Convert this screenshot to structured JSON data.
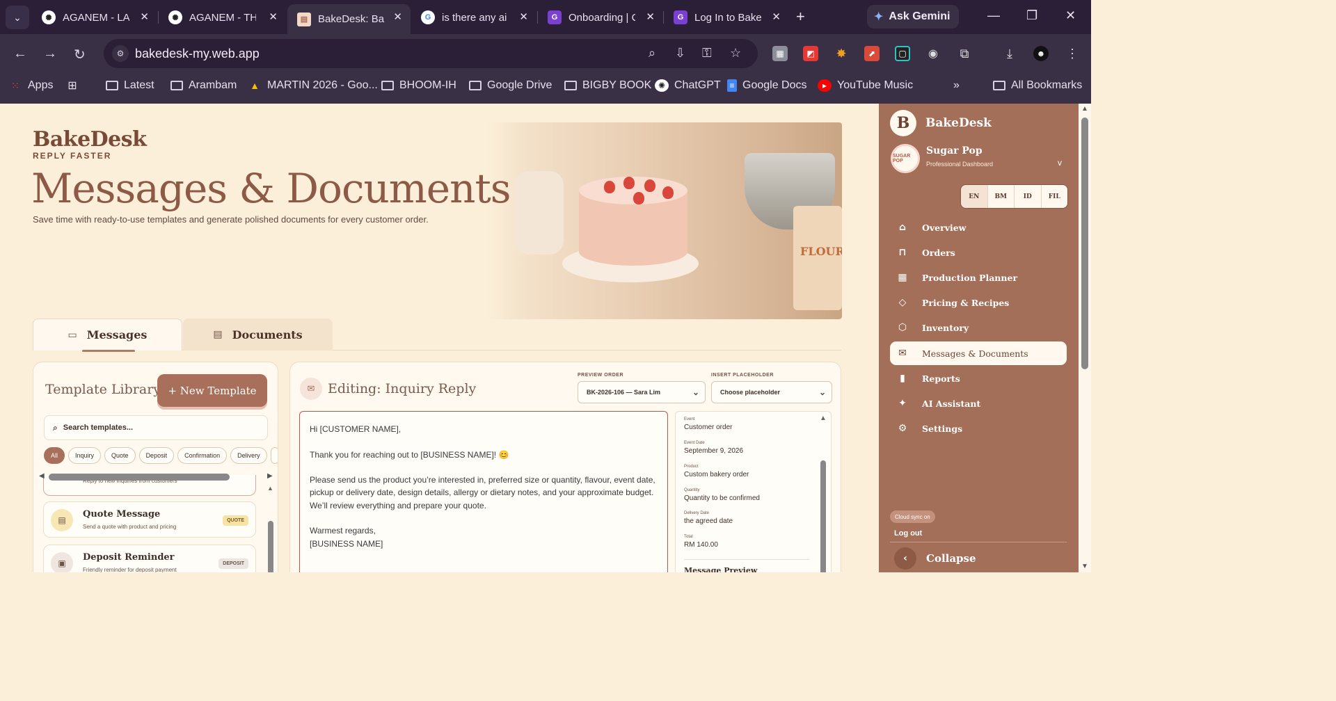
{
  "browser": {
    "tabs": [
      {
        "title": "AGANEM - LA",
        "favicon": "openai-icon"
      },
      {
        "title": "AGANEM - TH",
        "favicon": "openai-icon"
      },
      {
        "title": "BakeDesk: Bak",
        "favicon": "bakedesk-icon"
      },
      {
        "title": "is there any ai",
        "favicon": "google-icon"
      },
      {
        "title": "Onboarding | C",
        "favicon": "g-icon"
      },
      {
        "title": "Log In to Bake",
        "favicon": "g-icon"
      }
    ],
    "active_tab": 2,
    "gemini_label": "Ask Gemini",
    "url": "bakedesk-my.web.app",
    "bookmarks": [
      {
        "label": "Apps",
        "icon": "apps-grid-icon"
      },
      {
        "label": "",
        "icon": "grid-icon"
      },
      {
        "label": "Latest",
        "icon": "folder-icon"
      },
      {
        "label": "Arambam",
        "icon": "folder-icon"
      },
      {
        "label": "MARTIN 2026 - Goo...",
        "icon": "drive-icon"
      },
      {
        "label": "BHOOM-IH",
        "icon": "folder-icon"
      },
      {
        "label": "Google Drive",
        "icon": "folder-icon"
      },
      {
        "label": "BIGBY BOOK",
        "icon": "folder-icon"
      },
      {
        "label": "ChatGPT",
        "icon": "openai-icon"
      },
      {
        "label": "Google Docs",
        "icon": "docs-icon"
      },
      {
        "label": "YouTube Music",
        "icon": "youtube-music-icon"
      }
    ],
    "all_bookmarks": "All Bookmarks"
  },
  "hero": {
    "brand": "BakeDesk",
    "brand_tagline": "REPLY FASTER",
    "title": "Messages & Documents",
    "subtitle": "Save time with ready-to-use templates and generate polished documents for every customer order."
  },
  "page_tabs": {
    "messages": "Messages",
    "documents": "Documents"
  },
  "library": {
    "title": "Template Library",
    "new_button": "+ New Template",
    "search_placeholder": "Search templates...",
    "chips": [
      "All",
      "Inquiry",
      "Quote",
      "Deposit",
      "Confirmation",
      "Delivery"
    ],
    "active_chip": "All",
    "first_desc": "Reply to new inquiries from customers",
    "templates": [
      {
        "name": "Quote Message",
        "desc": "Send a quote with product and pricing",
        "tag": "QUOTE",
        "tag_color": "#f7e3a4"
      },
      {
        "name": "Deposit Reminder",
        "desc": "Friendly reminder for deposit payment",
        "tag": "DEPOSIT",
        "tag_color": "#ece6e3"
      }
    ]
  },
  "editor": {
    "title": "Editing: Inquiry Reply",
    "preview_order_label": "PREVIEW ORDER",
    "preview_order_value": "BK-2026-106 — Sara Lim",
    "placeholder_label": "INSERT PLACEHOLDER",
    "placeholder_value": "Choose placeholder",
    "message_lines": {
      "greeting": "Hi [CUSTOMER NAME],",
      "thanks": "Thank you for reaching out to [BUSINESS NAME]! 😊",
      "body": "Please send us the product you’re interested in, preferred size or quantity, flavour, event date, pickup or delivery date, design details, allergy or dietary notes, and your approximate budget. We’ll review everything and prepare your quote.",
      "closing": "Warmest regards,",
      "signature": "[BUSINESS NAME]"
    },
    "preview": [
      {
        "key": "Event",
        "value": "Customer order"
      },
      {
        "key": "Event Date",
        "value": "September 9, 2026"
      },
      {
        "key": "Product",
        "value": "Custom bakery order"
      },
      {
        "key": "Quantity",
        "value": "Quantity to be confirmed"
      },
      {
        "key": "Delivery Date",
        "value": "the agreed date"
      },
      {
        "key": "Total",
        "value": "RM 140.00"
      }
    ],
    "preview_more": "Message Preview"
  },
  "sidebar": {
    "logo_letter": "B",
    "app_name": "BakeDesk",
    "org_name": "Sugar Pop",
    "org_sub": "Professional Dashboard",
    "org_avatar_text": "SUGAR POP",
    "languages": [
      "EN",
      "BM",
      "ID",
      "FIL"
    ],
    "active_language": "EN",
    "items": [
      {
        "label": "Overview",
        "icon": "home-icon"
      },
      {
        "label": "Orders",
        "icon": "bag-icon"
      },
      {
        "label": "Production Planner",
        "icon": "calendar-icon"
      },
      {
        "label": "Pricing & Recipes",
        "icon": "tag-icon"
      },
      {
        "label": "Inventory",
        "icon": "box-icon"
      },
      {
        "label": "Messages & Documents",
        "icon": "mail-icon"
      },
      {
        "label": "Reports",
        "icon": "bar-chart-icon"
      },
      {
        "label": "AI Assistant",
        "icon": "sparkle-icon"
      },
      {
        "label": "Settings",
        "icon": "gear-icon"
      }
    ],
    "active_item": "Messages & Documents",
    "sync_badge": "Cloud sync on",
    "logout": "Log out",
    "collapse": "Collapse"
  }
}
